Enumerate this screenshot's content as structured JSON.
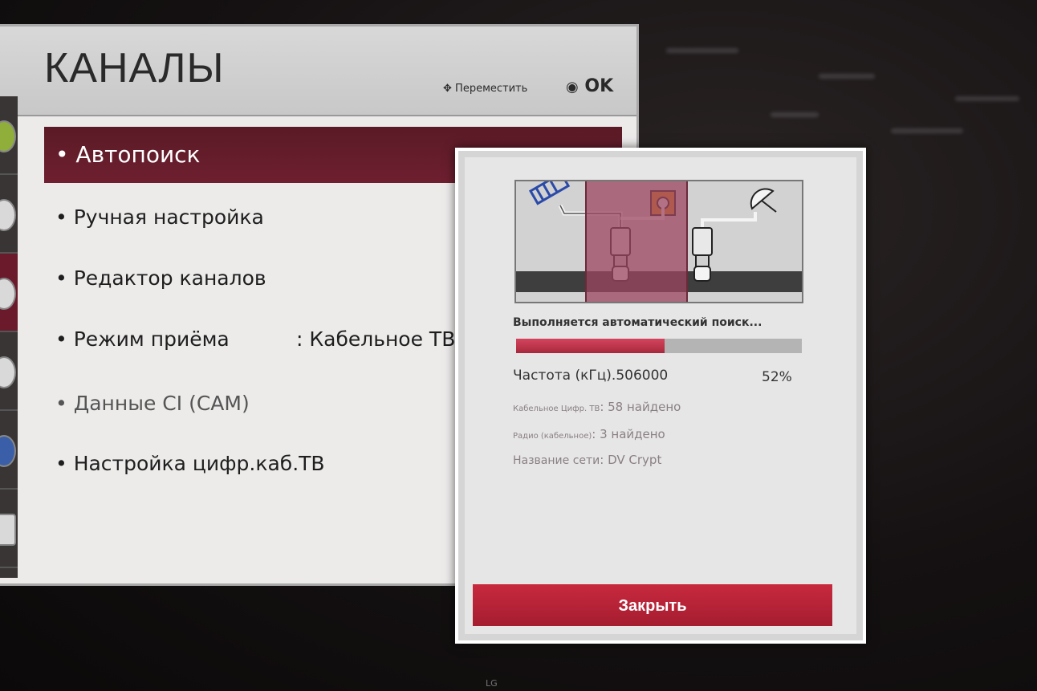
{
  "menu": {
    "title": "КАНАЛЫ",
    "hint_move": "Переместить",
    "hint_ok": "OK",
    "items": [
      {
        "label": "• Автопоиск",
        "selected": true
      },
      {
        "label": "• Ручная настройка"
      },
      {
        "label": "• Редактор каналов"
      },
      {
        "label": "• Режим приёма",
        "value": ": Кабельное ТВ"
      },
      {
        "label": "• Данные CI (CAM)",
        "dimmed": true
      },
      {
        "label": "• Настройка цифр.каб.ТВ"
      }
    ]
  },
  "dialog": {
    "status": "Выполняется автоматический поиск...",
    "frequency": "Частота (кГц).506000",
    "progress_percent": 52,
    "percent_label": "52%",
    "cable_digital_label": "Кабельное Цифр. ТВ",
    "cable_digital_value": "58 найдено",
    "radio_label": "Радио (кабельное)",
    "radio_value": "3 найдено",
    "network_label": "Название сети",
    "network_value": "DV Crypt",
    "close_label": "Закрыть"
  },
  "brand": "LG",
  "colors": {
    "accent_red": "#b7223a",
    "selected_row": "#6e1f30"
  }
}
